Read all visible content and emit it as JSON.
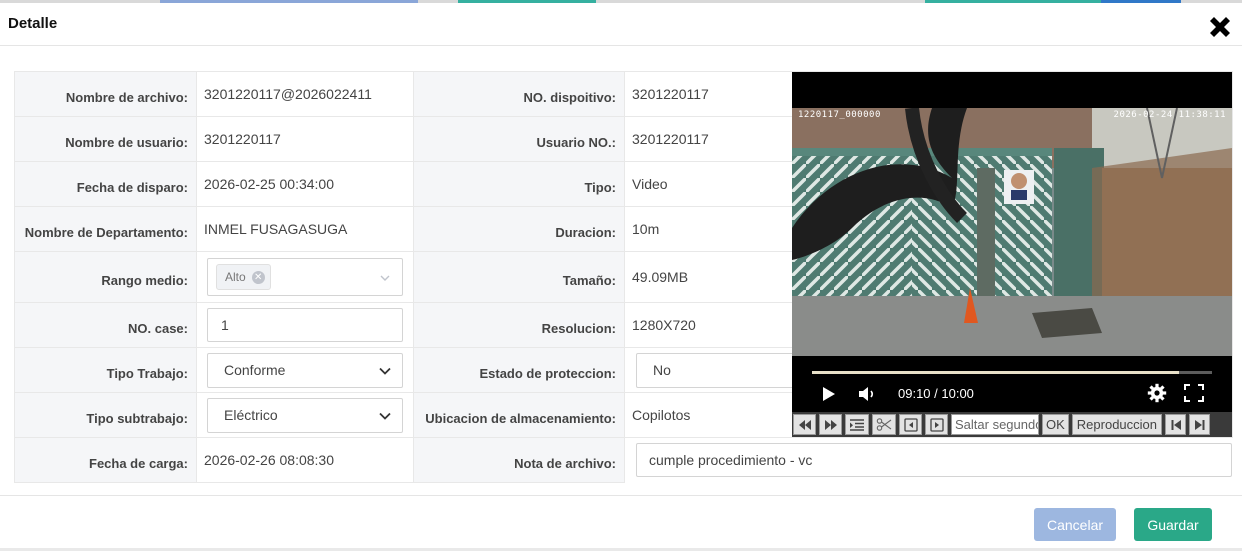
{
  "modal": {
    "title": "Detalle"
  },
  "colors": {
    "accent_green": "#2aa888",
    "cancel_blue": "#9db7e0",
    "label_bg": "#f5f6f8"
  },
  "fields": {
    "nombre_archivo": {
      "label": "Nombre de archivo:",
      "value": "3201220117@2026022411"
    },
    "no_dispositivo": {
      "label": "NO. dispoitivo:",
      "value": "3201220117"
    },
    "nombre_usuario": {
      "label": "Nombre de usuario:",
      "value": "3201220117"
    },
    "usuario_no": {
      "label": "Usuario NO.:",
      "value": "3201220117"
    },
    "fecha_disparo": {
      "label": "Fecha de disparo:",
      "value": "2026-02-25 00:34:00"
    },
    "tipo": {
      "label": "Tipo:",
      "value": "Video"
    },
    "nombre_departamento": {
      "label": "Nombre de Departamento:",
      "value": "INMEL FUSAGASUGA"
    },
    "duracion": {
      "label": "Duracion:",
      "value": "10m"
    },
    "rango_medio": {
      "label": "Rango medio:",
      "tag": "Alto",
      "tag_remove": "✕"
    },
    "tamano": {
      "label": "Tamaño:",
      "value": "49.09MB"
    },
    "no_case": {
      "label": "NO. case:",
      "value": "1"
    },
    "resolucion": {
      "label": "Resolucion:",
      "value": "1280X720"
    },
    "tipo_trabajo": {
      "label": "Tipo Trabajo:",
      "value": "Conforme"
    },
    "estado_proteccion": {
      "label": "Estado de proteccion:",
      "value": "No"
    },
    "tipo_subtrabajo": {
      "label": "Tipo subtrabajo:",
      "value": "Eléctrico"
    },
    "ubicacion_almacenamiento": {
      "label": "Ubicacion de almacenamiento:",
      "value": "Copilotos"
    },
    "fecha_carga": {
      "label": "Fecha de carga:",
      "value": "2026-02-26 08:08:30"
    },
    "nota_archivo": {
      "label": "Nota de archivo:",
      "value": "cumple procedimiento - vc"
    }
  },
  "player": {
    "osd_left": "1220117_000000",
    "osd_right": "2026-02-24 11:38:11",
    "time": "09:10 / 10:00",
    "progress": 0.917,
    "icons": [
      "play-icon",
      "volume-icon",
      "settings-gear-icon",
      "fullscreen-icon"
    ]
  },
  "toolbar": {
    "skip_placeholder": "Saltar segundos",
    "ok_label": "OK",
    "playback_label": "Reproduccion",
    "icons": [
      "rewind-icon",
      "fast-forward-icon",
      "list-indent-icon",
      "scissors-icon",
      "prev-frame-icon",
      "next-frame-icon",
      "skip-start-icon",
      "skip-end-icon"
    ]
  },
  "footer": {
    "cancel_label": "Cancelar",
    "save_label": "Guardar"
  }
}
